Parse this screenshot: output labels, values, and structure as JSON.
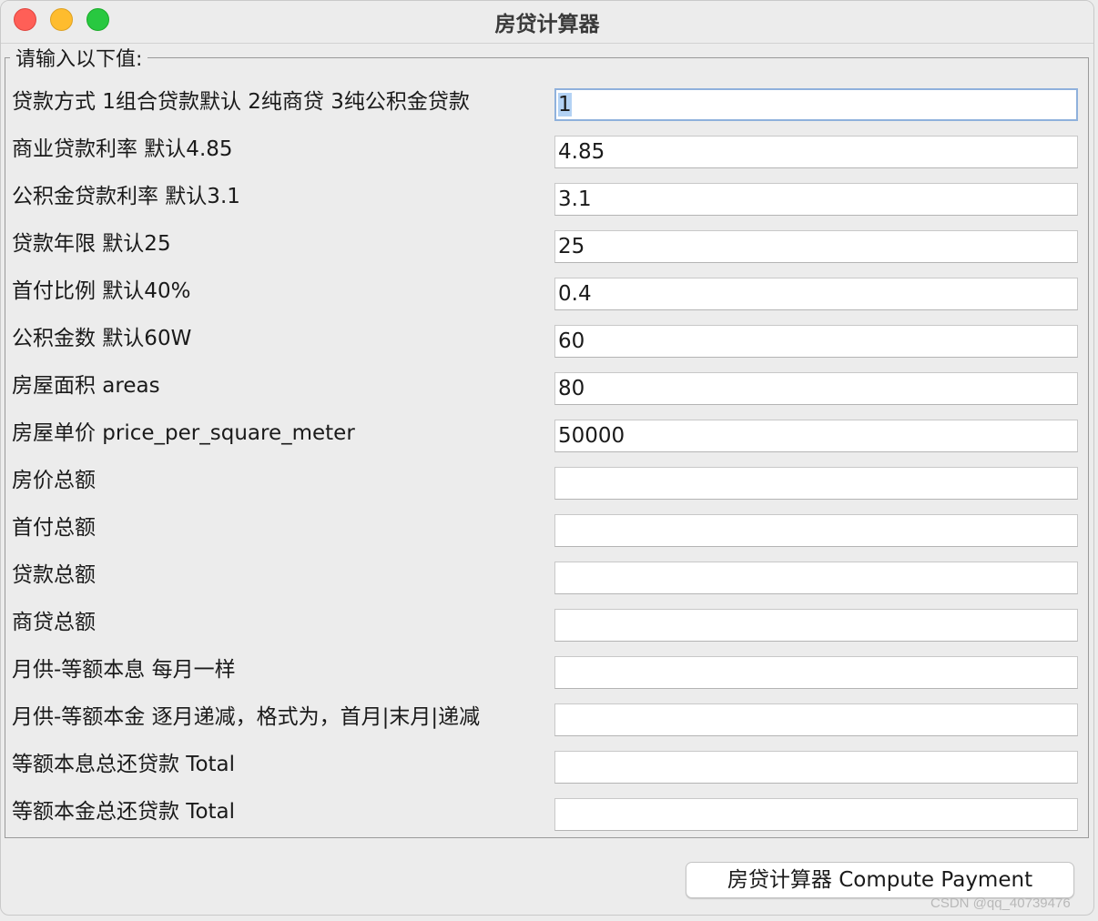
{
  "window": {
    "title": "房贷计算器"
  },
  "form": {
    "group_title": "请输入以下值:",
    "rows": [
      {
        "label": "贷款方式 1组合贷款默认 2纯商贷 3纯公积金贷款",
        "value": "1"
      },
      {
        "label": "商业贷款利率 默认4.85",
        "value": "4.85"
      },
      {
        "label": "公积金贷款利率 默认3.1",
        "value": "3.1"
      },
      {
        "label": "贷款年限 默认25",
        "value": "25"
      },
      {
        "label": "首付比例 默认40%",
        "value": "0.4"
      },
      {
        "label": "公积金数 默认60W",
        "value": "60"
      },
      {
        "label": "房屋面积 areas",
        "value": "80"
      },
      {
        "label": "房屋单价 price_per_square_meter",
        "value": "50000"
      },
      {
        "label": "房价总额",
        "value": ""
      },
      {
        "label": "首付总额",
        "value": ""
      },
      {
        "label": "贷款总额",
        "value": ""
      },
      {
        "label": "商贷总额",
        "value": ""
      },
      {
        "label": "月供-等额本息 每月一样",
        "value": ""
      },
      {
        "label": "月供-等额本金 逐月递减，格式为，首月|末月|递减",
        "value": ""
      },
      {
        "label": "等额本息总还贷款 Total",
        "value": ""
      },
      {
        "label": "等额本金总还贷款 Total",
        "value": ""
      }
    ]
  },
  "actions": {
    "compute_label": "房贷计算器 Compute Payment"
  },
  "watermark": "CSDN @qq_40739476"
}
